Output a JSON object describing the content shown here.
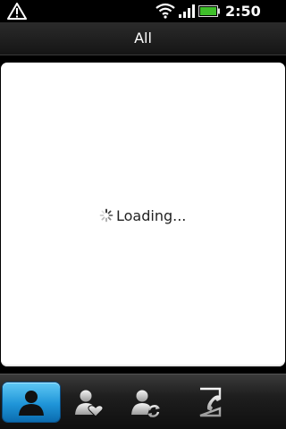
{
  "status_bar": {
    "time": "2:50 AM",
    "icons": [
      "warning-icon",
      "wifi-icon",
      "signal-icon",
      "battery-icon"
    ],
    "battery_color": "#3fbf2a"
  },
  "header": {
    "title": "All"
  },
  "main": {
    "loading_text": "Loading..."
  },
  "tabs": [
    {
      "name": "people",
      "icon": "person-icon",
      "active": true
    },
    {
      "name": "favorites",
      "icon": "person-heart-icon",
      "active": false
    },
    {
      "name": "groups-sync",
      "icon": "person-sync-icon",
      "active": false
    },
    {
      "name": "call-history",
      "icon": "call-history-icon",
      "active": false
    }
  ],
  "colors": {
    "accent": "#1f95d8"
  }
}
